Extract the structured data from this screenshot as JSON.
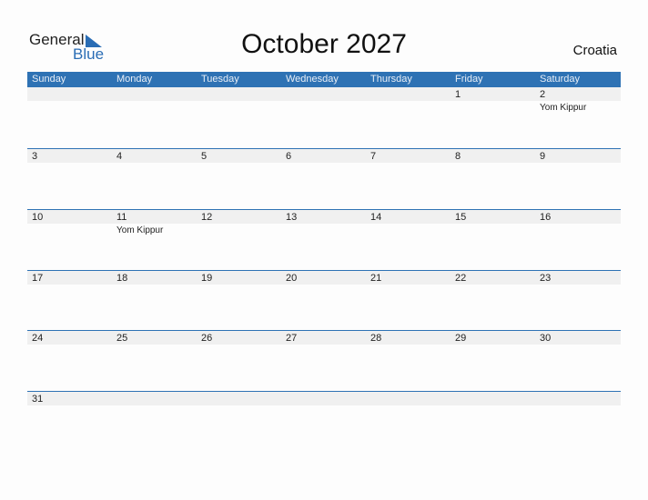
{
  "logo": {
    "general": "General",
    "blue": "Blue"
  },
  "title": "October 2027",
  "country": "Croatia",
  "days": [
    "Sunday",
    "Monday",
    "Tuesday",
    "Wednesday",
    "Thursday",
    "Friday",
    "Saturday"
  ],
  "weeks": [
    [
      {
        "d": ""
      },
      {
        "d": ""
      },
      {
        "d": ""
      },
      {
        "d": ""
      },
      {
        "d": ""
      },
      {
        "d": "1"
      },
      {
        "d": "2",
        "e": "Yom Kippur"
      }
    ],
    [
      {
        "d": "3"
      },
      {
        "d": "4"
      },
      {
        "d": "5"
      },
      {
        "d": "6"
      },
      {
        "d": "7"
      },
      {
        "d": "8"
      },
      {
        "d": "9"
      }
    ],
    [
      {
        "d": "10"
      },
      {
        "d": "11",
        "e": "Yom Kippur"
      },
      {
        "d": "12"
      },
      {
        "d": "13"
      },
      {
        "d": "14"
      },
      {
        "d": "15"
      },
      {
        "d": "16"
      }
    ],
    [
      {
        "d": "17"
      },
      {
        "d": "18"
      },
      {
        "d": "19"
      },
      {
        "d": "20"
      },
      {
        "d": "21"
      },
      {
        "d": "22"
      },
      {
        "d": "23"
      }
    ],
    [
      {
        "d": "24"
      },
      {
        "d": "25"
      },
      {
        "d": "26"
      },
      {
        "d": "27"
      },
      {
        "d": "28"
      },
      {
        "d": "29"
      },
      {
        "d": "30"
      }
    ],
    [
      {
        "d": "31"
      },
      {
        "d": ""
      },
      {
        "d": ""
      },
      {
        "d": ""
      },
      {
        "d": ""
      },
      {
        "d": ""
      },
      {
        "d": ""
      }
    ]
  ],
  "colors": {
    "accent": "#2e72b4",
    "strip": "#f0f0f0"
  }
}
